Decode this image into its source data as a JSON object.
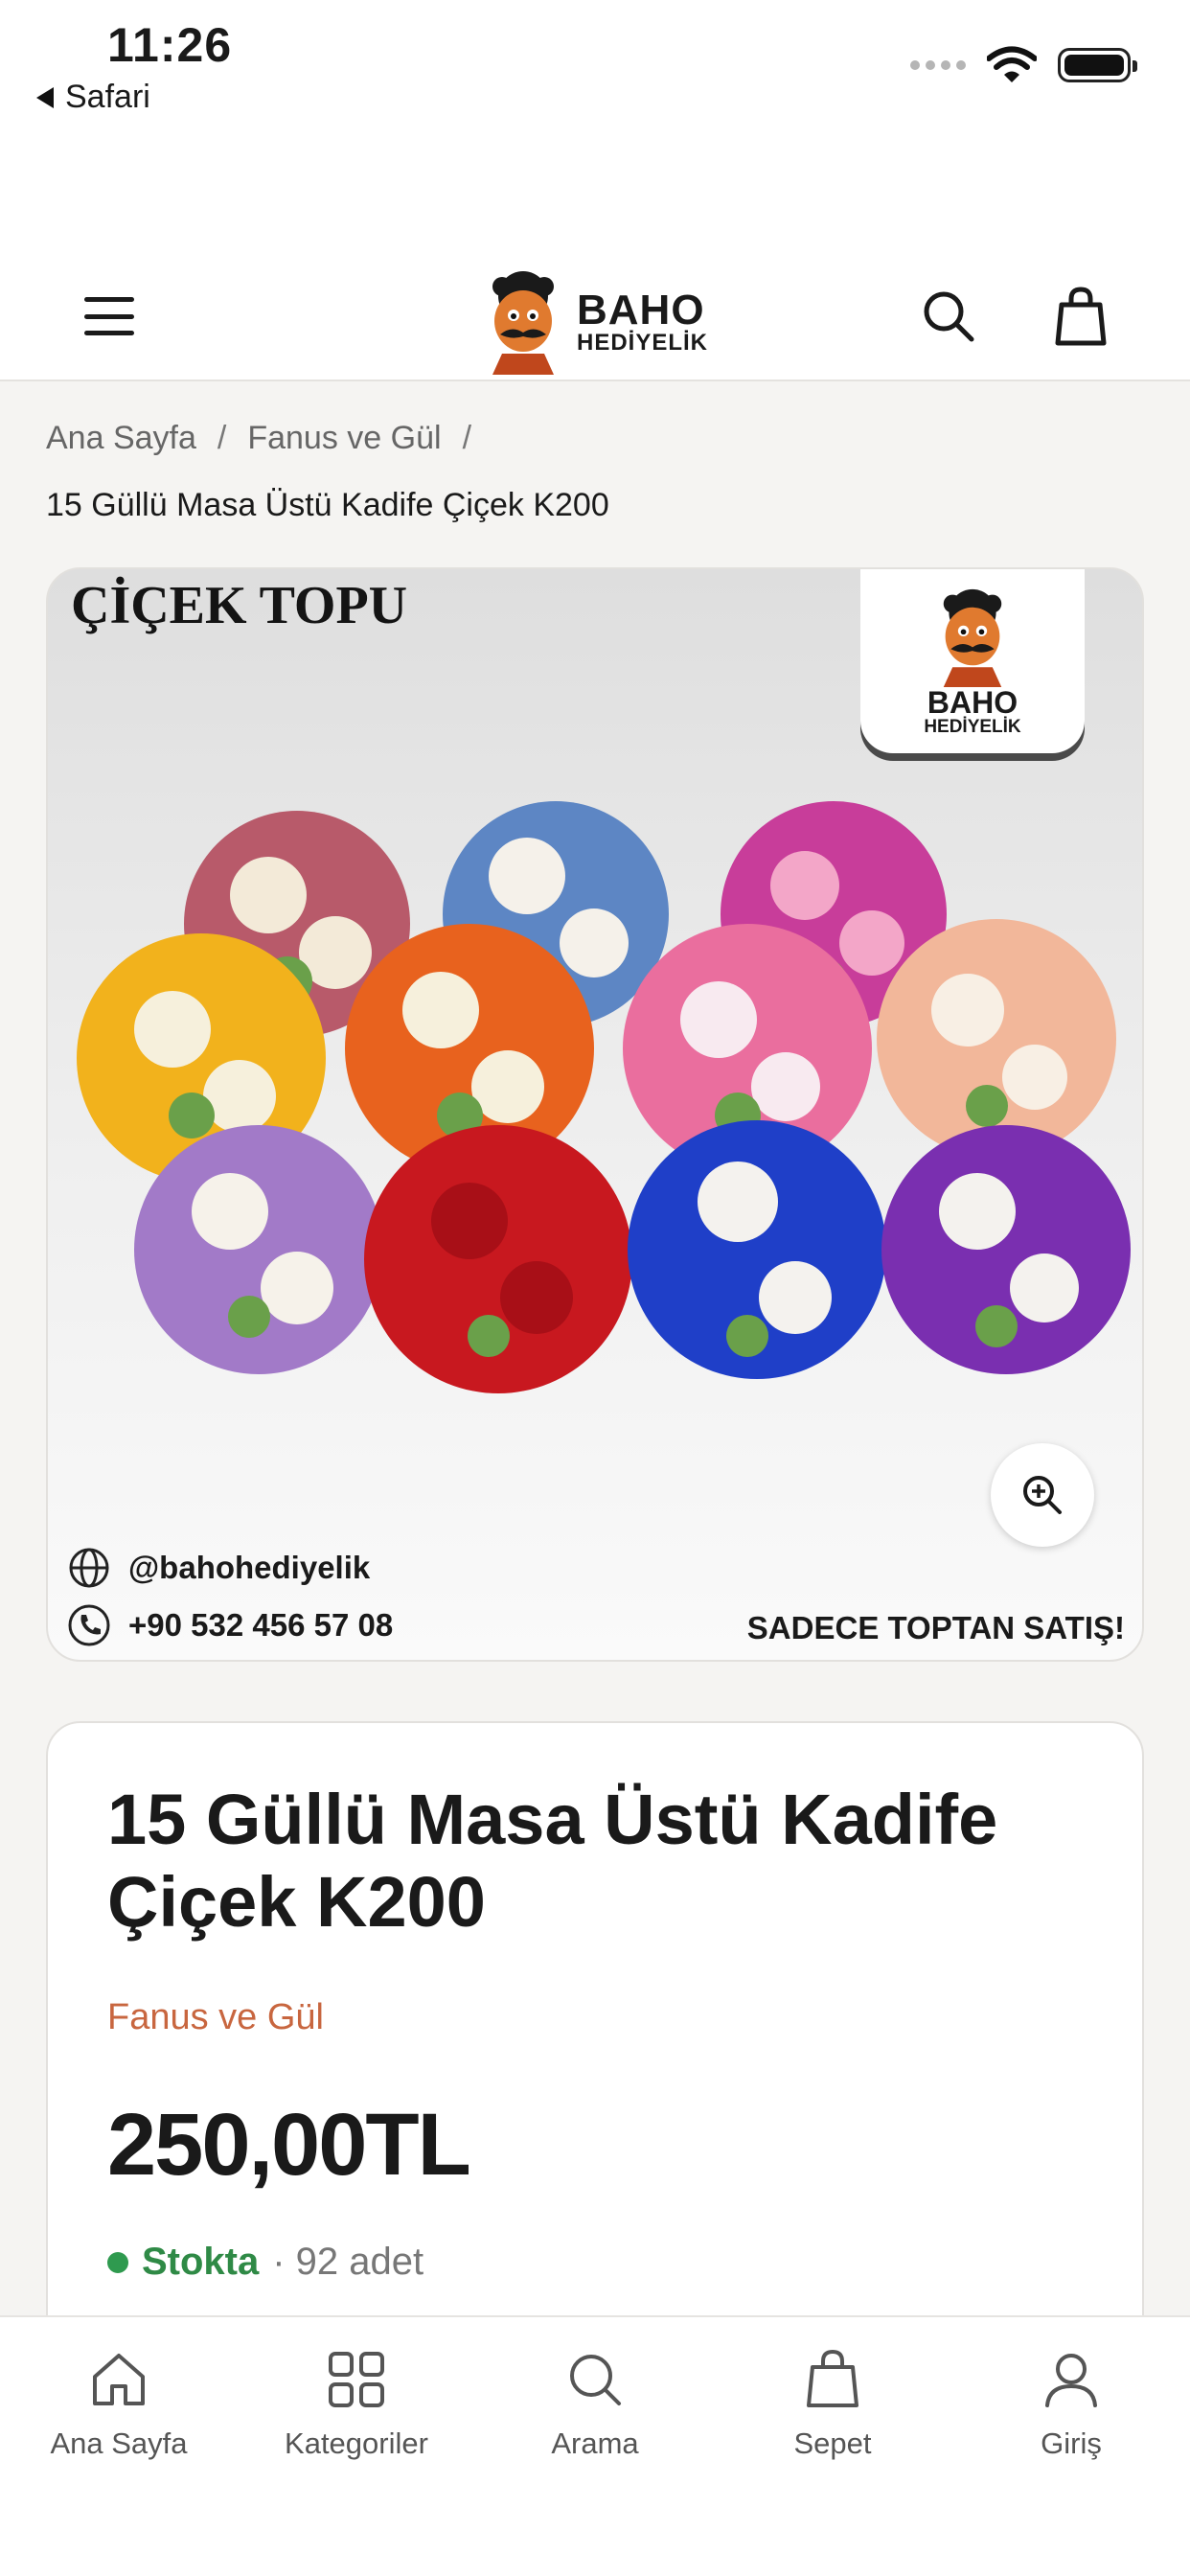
{
  "status_bar": {
    "time": "11:26",
    "back_app": "Safari"
  },
  "header": {
    "logo_line1": "BAHO",
    "logo_line2": "HEDİYELİK",
    "icons": [
      "menu-icon",
      "search-icon",
      "bag-icon"
    ]
  },
  "breadcrumb": {
    "items": [
      "Ana Sayfa",
      "Fanus ve Gül"
    ],
    "separator": "/",
    "current": "15 Güllü Masa Üstü Kadife Çiçek K200"
  },
  "hero": {
    "title": "ÇİÇEK TOPU",
    "badge_line1": "BAHO",
    "badge_line2": "HEDİYELİK",
    "instagram": "@bahohediyelik",
    "phone": "+90 532 456 57 08",
    "note": "SADECE TOPTAN SATIŞ!",
    "bouquet_colors": [
      "#b85a6a",
      "#5d86c4",
      "#c83d9a",
      "#f2b21c",
      "#e8621e",
      "#ea6e9e",
      "#f2b79a",
      "#a27ac8",
      "#c8181f",
      "#1f3fc8",
      "#7a2fb0"
    ]
  },
  "product": {
    "title": "15 Güllü Masa Üstü Kadife Çiçek K200",
    "category": "Fanus ve Gül",
    "price": "250,00TL",
    "stock_status": "Stokta",
    "stock_qty": "· 92 adet",
    "accent_color": "#c8663f",
    "stock_color": "#2f8a46"
  },
  "tabbar": {
    "tabs": [
      {
        "label": "Ana Sayfa",
        "icon": "home-icon"
      },
      {
        "label": "Kategoriler",
        "icon": "grid-icon"
      },
      {
        "label": "Arama",
        "icon": "search-icon"
      },
      {
        "label": "Sepet",
        "icon": "bag-icon"
      },
      {
        "label": "Giriş",
        "icon": "user-icon"
      }
    ]
  }
}
